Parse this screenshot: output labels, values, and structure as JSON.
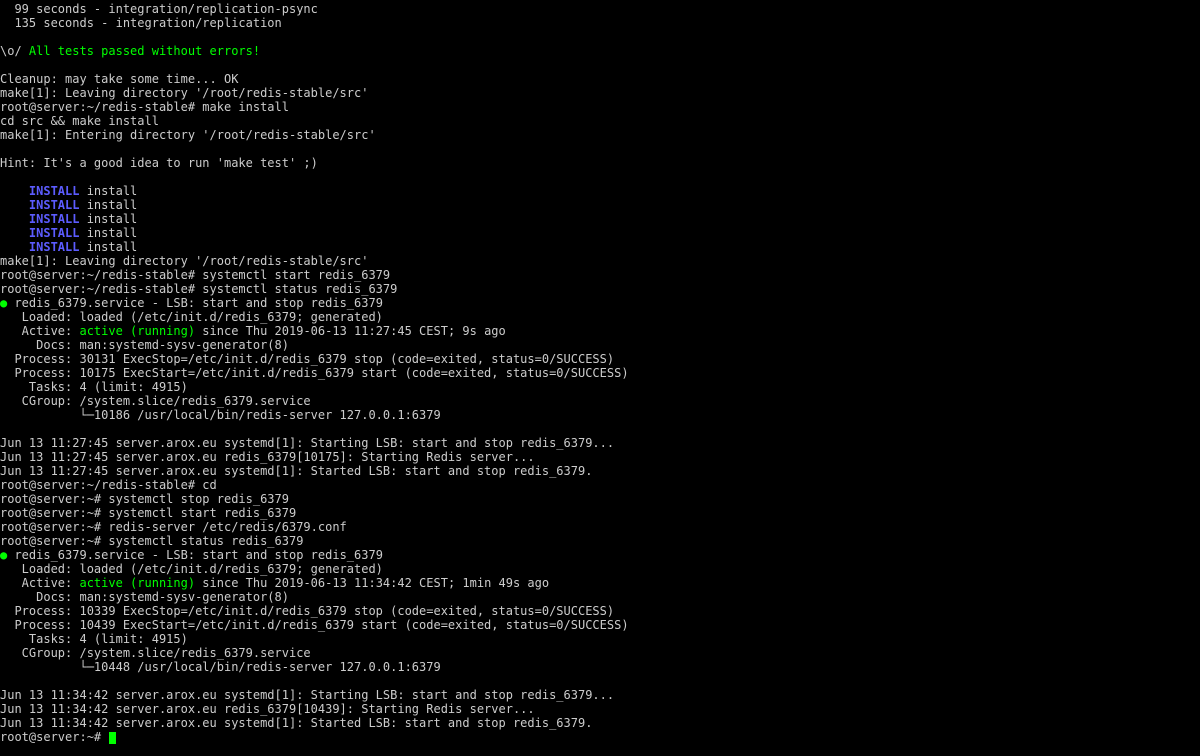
{
  "lines": [
    {
      "segs": [
        {
          "t": "  99 seconds - integration/replication-psync",
          "c": "white"
        }
      ]
    },
    {
      "segs": [
        {
          "t": "  135 seconds - integration/replication",
          "c": "white"
        }
      ]
    },
    {
      "segs": [
        {
          "t": "",
          "c": "white"
        }
      ]
    },
    {
      "segs": [
        {
          "t": "\\o/ ",
          "c": "white"
        },
        {
          "t": "All tests passed without errors!",
          "c": "green"
        }
      ]
    },
    {
      "segs": [
        {
          "t": "",
          "c": "white"
        }
      ]
    },
    {
      "segs": [
        {
          "t": "Cleanup: may take some time... OK",
          "c": "white"
        }
      ]
    },
    {
      "segs": [
        {
          "t": "make[1]: Leaving directory '/root/redis-stable/src'",
          "c": "white"
        }
      ]
    },
    {
      "segs": [
        {
          "t": "root@server:~/redis-stable# make install",
          "c": "white"
        }
      ]
    },
    {
      "segs": [
        {
          "t": "cd src && make install",
          "c": "white"
        }
      ]
    },
    {
      "segs": [
        {
          "t": "make[1]: Entering directory '/root/redis-stable/src'",
          "c": "white"
        }
      ]
    },
    {
      "segs": [
        {
          "t": "",
          "c": "white"
        }
      ]
    },
    {
      "segs": [
        {
          "t": "Hint: It's a good idea to run 'make test' ;)",
          "c": "white"
        }
      ]
    },
    {
      "segs": [
        {
          "t": "",
          "c": "white"
        }
      ]
    },
    {
      "segs": [
        {
          "t": "    ",
          "c": "white"
        },
        {
          "t": "INSTALL",
          "c": "blue"
        },
        {
          "t": " install",
          "c": "white"
        }
      ]
    },
    {
      "segs": [
        {
          "t": "    ",
          "c": "white"
        },
        {
          "t": "INSTALL",
          "c": "blue"
        },
        {
          "t": " install",
          "c": "white"
        }
      ]
    },
    {
      "segs": [
        {
          "t": "    ",
          "c": "white"
        },
        {
          "t": "INSTALL",
          "c": "blue"
        },
        {
          "t": " install",
          "c": "white"
        }
      ]
    },
    {
      "segs": [
        {
          "t": "    ",
          "c": "white"
        },
        {
          "t": "INSTALL",
          "c": "blue"
        },
        {
          "t": " install",
          "c": "white"
        }
      ]
    },
    {
      "segs": [
        {
          "t": "    ",
          "c": "white"
        },
        {
          "t": "INSTALL",
          "c": "blue"
        },
        {
          "t": " install",
          "c": "white"
        }
      ]
    },
    {
      "segs": [
        {
          "t": "make[1]: Leaving directory '/root/redis-stable/src'",
          "c": "white"
        }
      ]
    },
    {
      "segs": [
        {
          "t": "root@server:~/redis-stable# systemctl start redis_6379",
          "c": "white"
        }
      ]
    },
    {
      "segs": [
        {
          "t": "root@server:~/redis-stable# systemctl status redis_6379",
          "c": "white"
        }
      ]
    },
    {
      "segs": [
        {
          "t": "●",
          "c": "green"
        },
        {
          "t": " redis_6379.service - LSB: start and stop redis_6379",
          "c": "white"
        }
      ]
    },
    {
      "segs": [
        {
          "t": "   Loaded: loaded (/etc/init.d/redis_6379; generated)",
          "c": "white"
        }
      ]
    },
    {
      "segs": [
        {
          "t": "   Active: ",
          "c": "white"
        },
        {
          "t": "active (running)",
          "c": "green"
        },
        {
          "t": " since Thu 2019-06-13 11:27:45 CEST; 9s ago",
          "c": "white"
        }
      ]
    },
    {
      "segs": [
        {
          "t": "     Docs: man:systemd-sysv-generator(8)",
          "c": "white"
        }
      ]
    },
    {
      "segs": [
        {
          "t": "  Process: 30131 ExecStop=/etc/init.d/redis_6379 stop (code=exited, status=0/SUCCESS)",
          "c": "white"
        }
      ]
    },
    {
      "segs": [
        {
          "t": "  Process: 10175 ExecStart=/etc/init.d/redis_6379 start (code=exited, status=0/SUCCESS)",
          "c": "white"
        }
      ]
    },
    {
      "segs": [
        {
          "t": "    Tasks: 4 (limit: 4915)",
          "c": "white"
        }
      ]
    },
    {
      "segs": [
        {
          "t": "   CGroup: /system.slice/redis_6379.service",
          "c": "white"
        }
      ]
    },
    {
      "segs": [
        {
          "t": "           └─10186 /usr/local/bin/redis-server 127.0.0.1:6379",
          "c": "white"
        }
      ]
    },
    {
      "segs": [
        {
          "t": "",
          "c": "white"
        }
      ]
    },
    {
      "segs": [
        {
          "t": "Jun 13 11:27:45 server.arox.eu systemd[1]: Starting LSB: start and stop redis_6379...",
          "c": "white"
        }
      ]
    },
    {
      "segs": [
        {
          "t": "Jun 13 11:27:45 server.arox.eu redis_6379[10175]: Starting Redis server...",
          "c": "white"
        }
      ]
    },
    {
      "segs": [
        {
          "t": "Jun 13 11:27:45 server.arox.eu systemd[1]: Started LSB: start and stop redis_6379.",
          "c": "white"
        }
      ]
    },
    {
      "segs": [
        {
          "t": "root@server:~/redis-stable# cd",
          "c": "white"
        }
      ]
    },
    {
      "segs": [
        {
          "t": "root@server:~# systemctl stop redis_6379",
          "c": "white"
        }
      ]
    },
    {
      "segs": [
        {
          "t": "root@server:~# systemctl start redis_6379",
          "c": "white"
        }
      ]
    },
    {
      "segs": [
        {
          "t": "root@server:~# redis-server /etc/redis/6379.conf",
          "c": "white"
        }
      ]
    },
    {
      "segs": [
        {
          "t": "root@server:~# systemctl status redis_6379",
          "c": "white"
        }
      ]
    },
    {
      "segs": [
        {
          "t": "●",
          "c": "green"
        },
        {
          "t": " redis_6379.service - LSB: start and stop redis_6379",
          "c": "white"
        }
      ]
    },
    {
      "segs": [
        {
          "t": "   Loaded: loaded (/etc/init.d/redis_6379; generated)",
          "c": "white"
        }
      ]
    },
    {
      "segs": [
        {
          "t": "   Active: ",
          "c": "white"
        },
        {
          "t": "active (running)",
          "c": "green"
        },
        {
          "t": " since Thu 2019-06-13 11:34:42 CEST; 1min 49s ago",
          "c": "white"
        }
      ]
    },
    {
      "segs": [
        {
          "t": "     Docs: man:systemd-sysv-generator(8)",
          "c": "white"
        }
      ]
    },
    {
      "segs": [
        {
          "t": "  Process: 10339 ExecStop=/etc/init.d/redis_6379 stop (code=exited, status=0/SUCCESS)",
          "c": "white"
        }
      ]
    },
    {
      "segs": [
        {
          "t": "  Process: 10439 ExecStart=/etc/init.d/redis_6379 start (code=exited, status=0/SUCCESS)",
          "c": "white"
        }
      ]
    },
    {
      "segs": [
        {
          "t": "    Tasks: 4 (limit: 4915)",
          "c": "white"
        }
      ]
    },
    {
      "segs": [
        {
          "t": "   CGroup: /system.slice/redis_6379.service",
          "c": "white"
        }
      ]
    },
    {
      "segs": [
        {
          "t": "           └─10448 /usr/local/bin/redis-server 127.0.0.1:6379",
          "c": "white"
        }
      ]
    },
    {
      "segs": [
        {
          "t": "",
          "c": "white"
        }
      ]
    },
    {
      "segs": [
        {
          "t": "Jun 13 11:34:42 server.arox.eu systemd[1]: Starting LSB: start and stop redis_6379...",
          "c": "white"
        }
      ]
    },
    {
      "segs": [
        {
          "t": "Jun 13 11:34:42 server.arox.eu redis_6379[10439]: Starting Redis server...",
          "c": "white"
        }
      ]
    },
    {
      "segs": [
        {
          "t": "Jun 13 11:34:42 server.arox.eu systemd[1]: Started LSB: start and stop redis_6379.",
          "c": "white"
        }
      ]
    },
    {
      "segs": [
        {
          "t": "root@server:~# ",
          "c": "white"
        }
      ],
      "cursor": true
    }
  ]
}
